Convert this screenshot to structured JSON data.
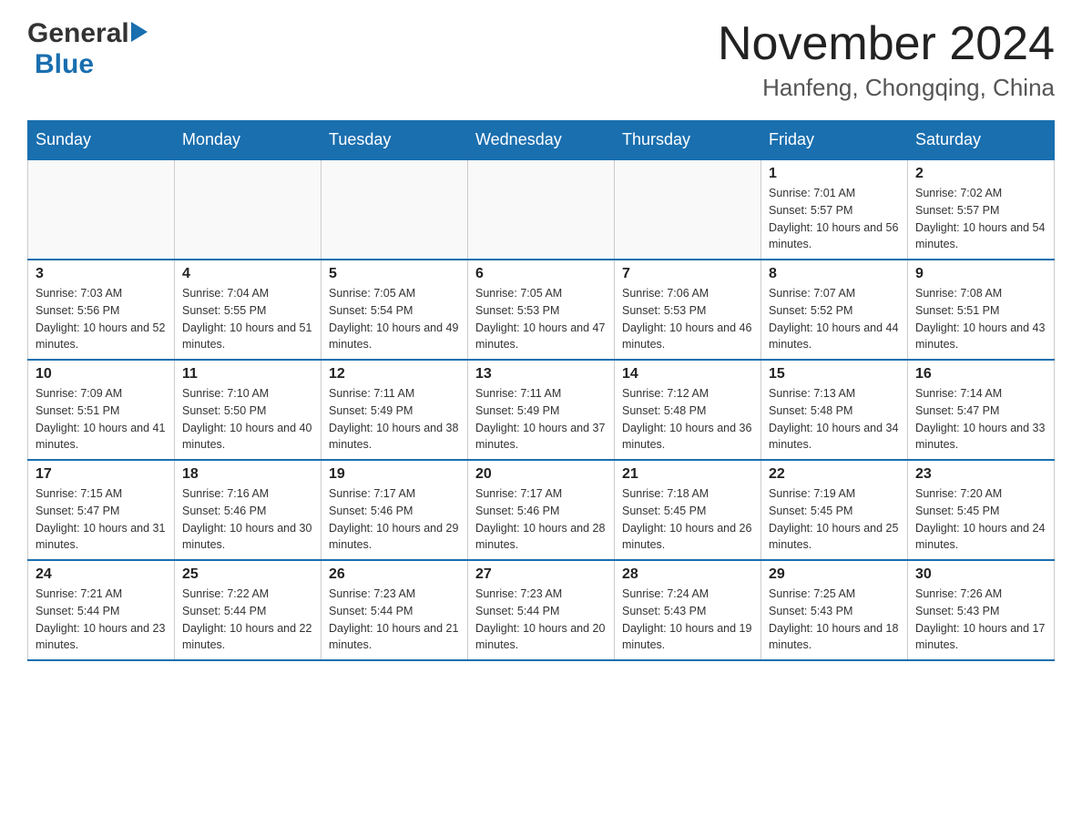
{
  "header": {
    "logo_general": "General",
    "logo_blue": "Blue",
    "month_year": "November 2024",
    "location": "Hanfeng, Chongqing, China"
  },
  "calendar": {
    "days_of_week": [
      "Sunday",
      "Monday",
      "Tuesday",
      "Wednesday",
      "Thursday",
      "Friday",
      "Saturday"
    ],
    "weeks": [
      [
        {
          "day": "",
          "info": ""
        },
        {
          "day": "",
          "info": ""
        },
        {
          "day": "",
          "info": ""
        },
        {
          "day": "",
          "info": ""
        },
        {
          "day": "",
          "info": ""
        },
        {
          "day": "1",
          "info": "Sunrise: 7:01 AM\nSunset: 5:57 PM\nDaylight: 10 hours and 56 minutes."
        },
        {
          "day": "2",
          "info": "Sunrise: 7:02 AM\nSunset: 5:57 PM\nDaylight: 10 hours and 54 minutes."
        }
      ],
      [
        {
          "day": "3",
          "info": "Sunrise: 7:03 AM\nSunset: 5:56 PM\nDaylight: 10 hours and 52 minutes."
        },
        {
          "day": "4",
          "info": "Sunrise: 7:04 AM\nSunset: 5:55 PM\nDaylight: 10 hours and 51 minutes."
        },
        {
          "day": "5",
          "info": "Sunrise: 7:05 AM\nSunset: 5:54 PM\nDaylight: 10 hours and 49 minutes."
        },
        {
          "day": "6",
          "info": "Sunrise: 7:05 AM\nSunset: 5:53 PM\nDaylight: 10 hours and 47 minutes."
        },
        {
          "day": "7",
          "info": "Sunrise: 7:06 AM\nSunset: 5:53 PM\nDaylight: 10 hours and 46 minutes."
        },
        {
          "day": "8",
          "info": "Sunrise: 7:07 AM\nSunset: 5:52 PM\nDaylight: 10 hours and 44 minutes."
        },
        {
          "day": "9",
          "info": "Sunrise: 7:08 AM\nSunset: 5:51 PM\nDaylight: 10 hours and 43 minutes."
        }
      ],
      [
        {
          "day": "10",
          "info": "Sunrise: 7:09 AM\nSunset: 5:51 PM\nDaylight: 10 hours and 41 minutes."
        },
        {
          "day": "11",
          "info": "Sunrise: 7:10 AM\nSunset: 5:50 PM\nDaylight: 10 hours and 40 minutes."
        },
        {
          "day": "12",
          "info": "Sunrise: 7:11 AM\nSunset: 5:49 PM\nDaylight: 10 hours and 38 minutes."
        },
        {
          "day": "13",
          "info": "Sunrise: 7:11 AM\nSunset: 5:49 PM\nDaylight: 10 hours and 37 minutes."
        },
        {
          "day": "14",
          "info": "Sunrise: 7:12 AM\nSunset: 5:48 PM\nDaylight: 10 hours and 36 minutes."
        },
        {
          "day": "15",
          "info": "Sunrise: 7:13 AM\nSunset: 5:48 PM\nDaylight: 10 hours and 34 minutes."
        },
        {
          "day": "16",
          "info": "Sunrise: 7:14 AM\nSunset: 5:47 PM\nDaylight: 10 hours and 33 minutes."
        }
      ],
      [
        {
          "day": "17",
          "info": "Sunrise: 7:15 AM\nSunset: 5:47 PM\nDaylight: 10 hours and 31 minutes."
        },
        {
          "day": "18",
          "info": "Sunrise: 7:16 AM\nSunset: 5:46 PM\nDaylight: 10 hours and 30 minutes."
        },
        {
          "day": "19",
          "info": "Sunrise: 7:17 AM\nSunset: 5:46 PM\nDaylight: 10 hours and 29 minutes."
        },
        {
          "day": "20",
          "info": "Sunrise: 7:17 AM\nSunset: 5:46 PM\nDaylight: 10 hours and 28 minutes."
        },
        {
          "day": "21",
          "info": "Sunrise: 7:18 AM\nSunset: 5:45 PM\nDaylight: 10 hours and 26 minutes."
        },
        {
          "day": "22",
          "info": "Sunrise: 7:19 AM\nSunset: 5:45 PM\nDaylight: 10 hours and 25 minutes."
        },
        {
          "day": "23",
          "info": "Sunrise: 7:20 AM\nSunset: 5:45 PM\nDaylight: 10 hours and 24 minutes."
        }
      ],
      [
        {
          "day": "24",
          "info": "Sunrise: 7:21 AM\nSunset: 5:44 PM\nDaylight: 10 hours and 23 minutes."
        },
        {
          "day": "25",
          "info": "Sunrise: 7:22 AM\nSunset: 5:44 PM\nDaylight: 10 hours and 22 minutes."
        },
        {
          "day": "26",
          "info": "Sunrise: 7:23 AM\nSunset: 5:44 PM\nDaylight: 10 hours and 21 minutes."
        },
        {
          "day": "27",
          "info": "Sunrise: 7:23 AM\nSunset: 5:44 PM\nDaylight: 10 hours and 20 minutes."
        },
        {
          "day": "28",
          "info": "Sunrise: 7:24 AM\nSunset: 5:43 PM\nDaylight: 10 hours and 19 minutes."
        },
        {
          "day": "29",
          "info": "Sunrise: 7:25 AM\nSunset: 5:43 PM\nDaylight: 10 hours and 18 minutes."
        },
        {
          "day": "30",
          "info": "Sunrise: 7:26 AM\nSunset: 5:43 PM\nDaylight: 10 hours and 17 minutes."
        }
      ]
    ]
  }
}
